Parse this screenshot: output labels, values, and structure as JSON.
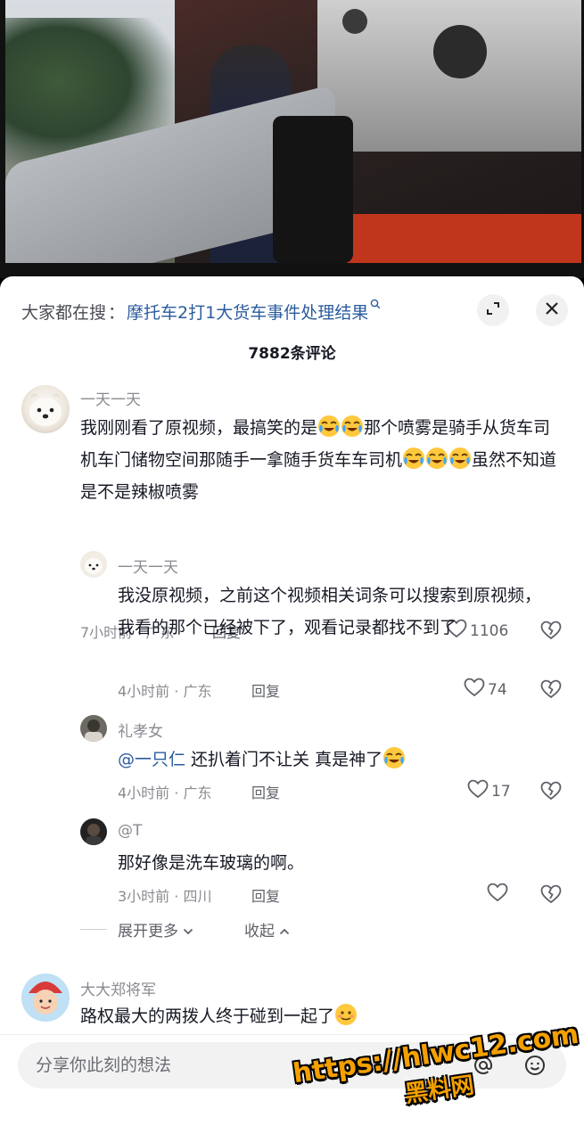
{
  "search": {
    "label": "大家都在搜",
    "colon": "：",
    "query": "摩托车2打1大货车事件处理结果"
  },
  "count_label": "7882条评论",
  "comments": [
    {
      "user": "一天一天",
      "text_a": "我刚刚看了原视频，最搞笑的是",
      "text_b": "那个喷雾是骑手从货车司机车门储物空间那随手一拿随手货车车司机",
      "text_c": "虽然不知道是不是辣椒喷雾",
      "time": "7小时前 · 广东",
      "reply": "回复",
      "likes": "1106"
    }
  ],
  "replies": [
    {
      "user": "一天一天",
      "text": "我没原视频，之前这个视频相关词条可以搜索到原视频，我看的那个已经被下了，观看记录都找不到了",
      "time": "4小时前 · 广东",
      "reply": "回复",
      "likes": "74"
    },
    {
      "user": "礼孝女",
      "mention": "@一只仁",
      "text": " 还扒着门不让关 真是神了",
      "time": "4小时前 · 广东",
      "reply": "回复",
      "likes": "17"
    },
    {
      "user": "@T",
      "text": "那好像是洗车玻璃的啊。",
      "time": "3小时前 · 四川",
      "reply": "回复",
      "likes": ""
    }
  ],
  "fold": {
    "expand": "展开更多",
    "collapse": "收起"
  },
  "last_comment": {
    "user": "大大郑将军",
    "text": "路权最大的两拨人终于碰到一起了"
  },
  "input": {
    "placeholder": "分享你此刻的想法"
  },
  "watermark": {
    "url": "https://hlwc12.com",
    "site": "黑料网"
  },
  "icons": {
    "expand": "expand-icon",
    "close": "close-icon",
    "like": "heart-icon",
    "dislike": "broken-heart-icon",
    "emoji_laugh": "laughing-tears-emoji",
    "emoji_sweat": "sweat-smile-emoji",
    "at": "at-icon",
    "emoji_picker": "emoji-icon"
  },
  "colors": {
    "link": "#2b5c9e",
    "text": "#161823",
    "muted": "#8a8b91"
  }
}
